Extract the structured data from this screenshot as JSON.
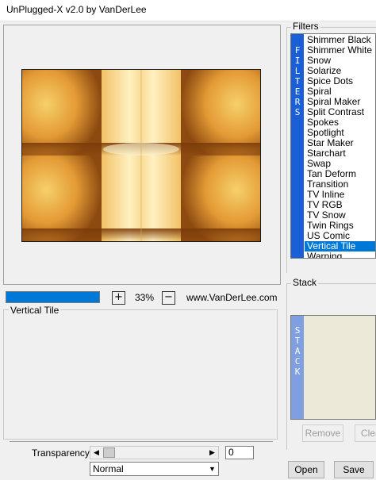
{
  "window": {
    "title": "UnPlugged-X v2.0 by VanDerLee"
  },
  "preview": {
    "progress_pct": 100,
    "zoom_in_label": "+",
    "zoom_value": "33%",
    "zoom_out_label": "−",
    "url": "www.VanDerLee.com"
  },
  "filter_panel": {
    "title": "Vertical Tile"
  },
  "filters": {
    "group_label": "Filters",
    "side_label": [
      "F",
      "I",
      "L",
      "T",
      "E",
      "R",
      "S"
    ],
    "items": [
      "Shimmer Black",
      "Shimmer White",
      "Snow",
      "Solarize",
      "Spice Dots",
      "Spiral",
      "Spiral Maker",
      "Split Contrast",
      "Spokes",
      "Spotlight",
      "Star Maker",
      "Starchart",
      "Swap",
      "Tan Deform",
      "Transition",
      "TV Inline",
      "TV RGB",
      "TV Snow",
      "Twin Rings",
      "US Comic",
      "Vertical Tile",
      "Warping"
    ],
    "selected": "Vertical Tile"
  },
  "stack": {
    "group_label": "Stack",
    "side_label": [
      "S",
      "T",
      "A",
      "C",
      "K"
    ],
    "remove_label": "Remove",
    "clear_label": "Clea"
  },
  "bottom": {
    "transparency_label": "Transparency",
    "transparency_value": "0",
    "blend_mode": "Normal",
    "open_label": "Open",
    "save_label": "Save"
  },
  "colors": {
    "accent": "#0078d7",
    "band": "#1a5fd8",
    "stack_band": "#7f9fe0"
  }
}
